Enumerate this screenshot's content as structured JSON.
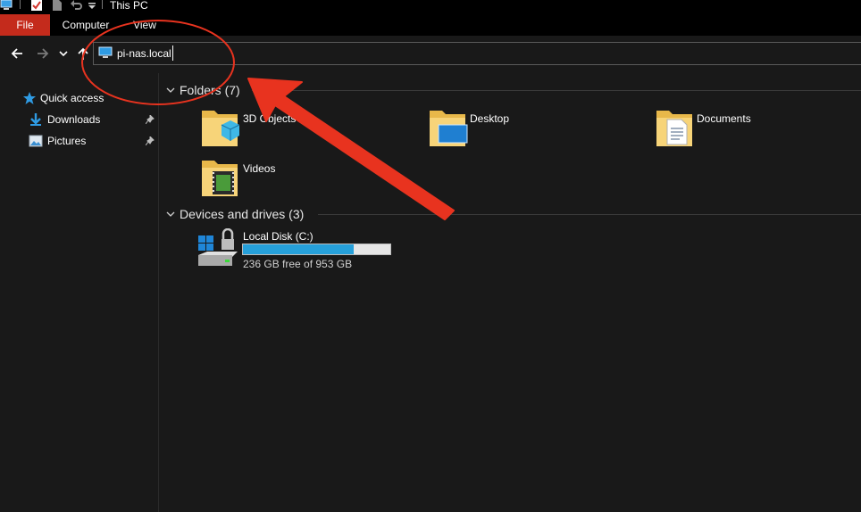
{
  "window": {
    "title": "This PC"
  },
  "ribbon": {
    "tabs": [
      "File",
      "Computer",
      "View"
    ],
    "active_tab": "File"
  },
  "address": {
    "value": "pi-nas.local"
  },
  "nav": {
    "items": [
      {
        "label": "Quick access",
        "icon": "star-icon",
        "pinned": false
      },
      {
        "label": "Downloads",
        "icon": "download-icon",
        "pinned": true
      },
      {
        "label": "Pictures",
        "icon": "pictures-icon",
        "pinned": true
      }
    ]
  },
  "groups": {
    "folders": {
      "title": "Folders (7)",
      "items": [
        "3D Objects",
        "Desktop",
        "Documents",
        "Videos"
      ]
    },
    "drives": {
      "title": "Devices and drives (3)",
      "items": [
        {
          "name": "Local Disk (C:)",
          "free_text": "236 GB free of 953 GB",
          "used_fraction": 0.75
        }
      ]
    }
  },
  "colors": {
    "accent_file_tab": "#c42b1c",
    "annotation_red": "#e8331f",
    "drive_fill": "#26a0da",
    "background": "#191919"
  }
}
